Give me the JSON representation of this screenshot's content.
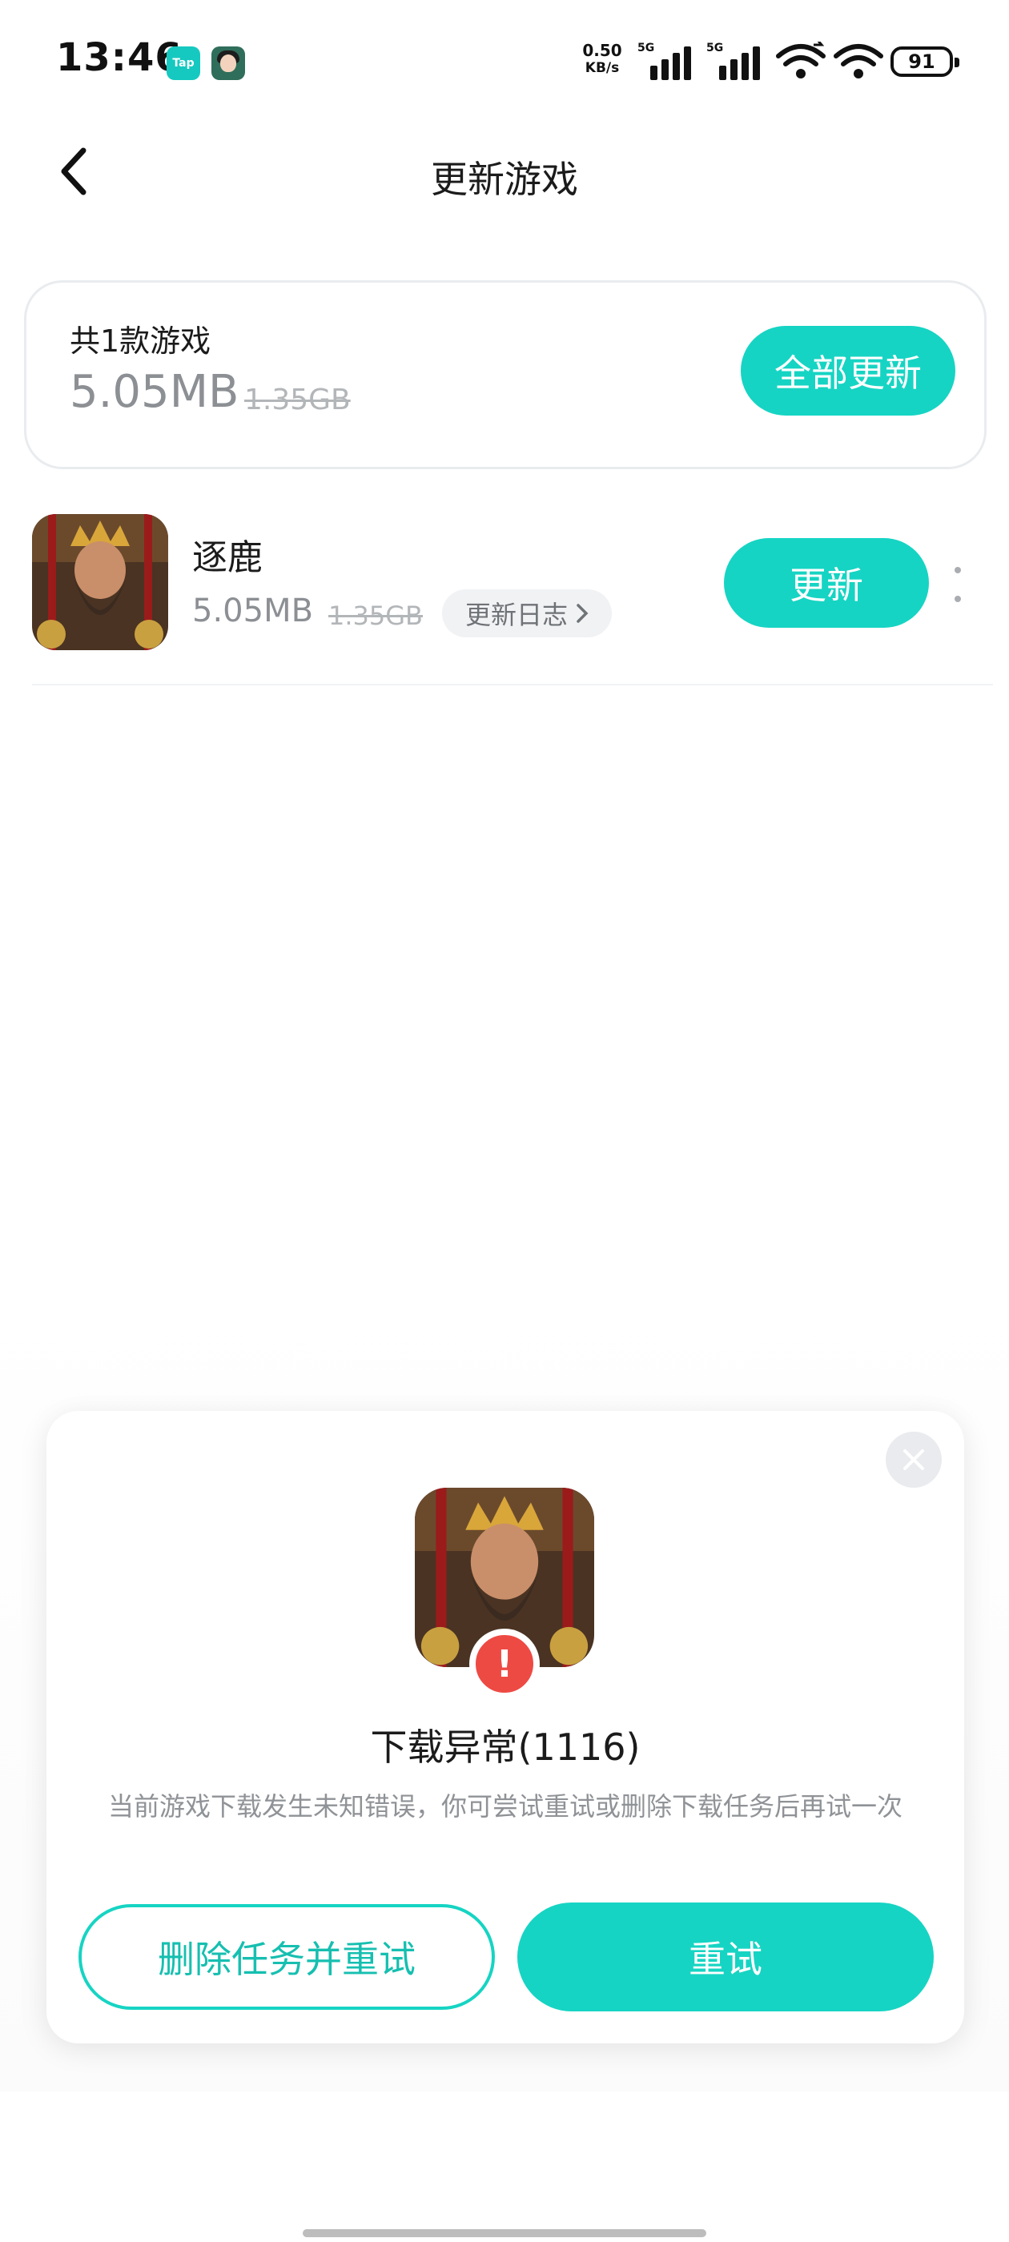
{
  "status_bar": {
    "time": "13:46",
    "taptap_badge": "Tap",
    "net_speed_value": "0.50",
    "net_speed_unit": "KB/s",
    "sim1_tag": "5G",
    "sim2_tag": "5G",
    "battery": "91"
  },
  "header": {
    "title": "更新游戏"
  },
  "summary": {
    "count_label": "共1款游戏",
    "size": "5.05MB",
    "old_size": "1.35GB",
    "update_all_label": "全部更新"
  },
  "games": [
    {
      "name": "逐鹿",
      "size": "5.05MB",
      "old_size": "1.35GB",
      "changelog_label": "更新日志",
      "update_label": "更新"
    }
  ],
  "dialog": {
    "title": "下载异常(1116)",
    "message": "当前游戏下载发生未知错误，你可尝试重试或删除下载任务后再试一次",
    "delete_retry_label": "删除任务并重试",
    "retry_label": "重试",
    "error_mark": "!"
  },
  "colors": {
    "accent": "#16d4c3",
    "error": "#ee4a44"
  }
}
